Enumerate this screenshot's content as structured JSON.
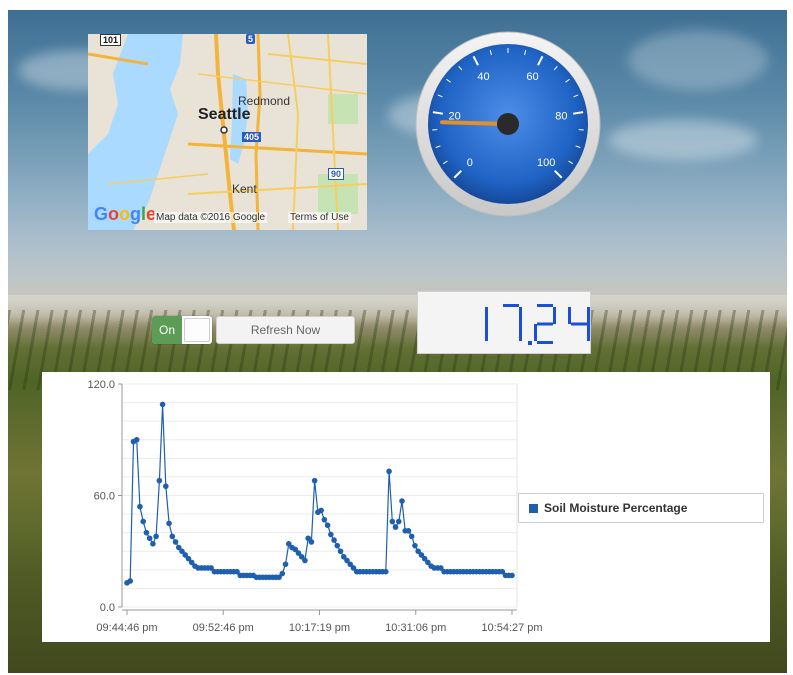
{
  "map": {
    "cities": {
      "seattle": "Seattle",
      "redmond": "Redmond",
      "kent": "Kent"
    },
    "shields": [
      "101",
      "5",
      "405",
      "90"
    ],
    "logo": "Google",
    "attribution": "Map data ©2016 Google",
    "terms": "Terms of Use"
  },
  "gauge": {
    "value": 17.24,
    "min": 0,
    "max": 100,
    "tick_labels": [
      "0",
      "20",
      "40",
      "60",
      "80",
      "100"
    ],
    "face_color": "#1f63c4",
    "needle_color": "#e0902d"
  },
  "controls": {
    "toggle_label": "On",
    "toggle_state": true,
    "refresh_label": "Refresh Now"
  },
  "display": {
    "value": "17.24"
  },
  "chart_data": {
    "type": "line",
    "ylim": [
      0,
      120
    ],
    "y_tick_labels": [
      "0.0",
      "60.0",
      "120.0"
    ],
    "x_tick_labels": [
      "09:44:46 pm",
      "09:52:46 pm",
      "10:17:19 pm",
      "10:31:06 pm",
      "10:54:27 pm"
    ],
    "series": [
      {
        "name": "Soil Moisture Percentage",
        "color": "#1f5fae",
        "values": [
          13,
          14,
          89,
          90,
          54,
          46,
          40,
          37,
          34,
          38,
          68,
          109,
          65,
          45,
          38,
          35,
          32,
          30,
          28,
          26,
          24,
          22,
          21,
          21,
          21,
          21,
          21,
          19,
          19,
          19,
          19,
          19,
          19,
          19,
          19,
          17,
          17,
          17,
          17,
          17,
          16,
          16,
          16,
          16,
          16,
          16,
          16,
          16,
          18,
          23,
          34,
          32,
          31,
          29,
          27,
          25,
          37,
          35,
          68,
          51,
          52,
          47,
          44,
          39,
          36,
          33,
          30,
          27,
          25,
          23,
          21,
          19,
          19,
          19,
          19,
          19,
          19,
          19,
          19,
          19,
          19,
          73,
          46,
          43,
          46,
          57,
          41,
          41,
          38,
          33,
          30,
          28,
          26,
          24,
          22,
          21,
          21,
          21,
          19,
          19,
          19,
          19,
          19,
          19,
          19,
          19,
          19,
          19,
          19,
          19,
          19,
          19,
          19,
          19,
          19,
          19,
          19,
          17,
          17,
          17
        ]
      }
    ]
  }
}
